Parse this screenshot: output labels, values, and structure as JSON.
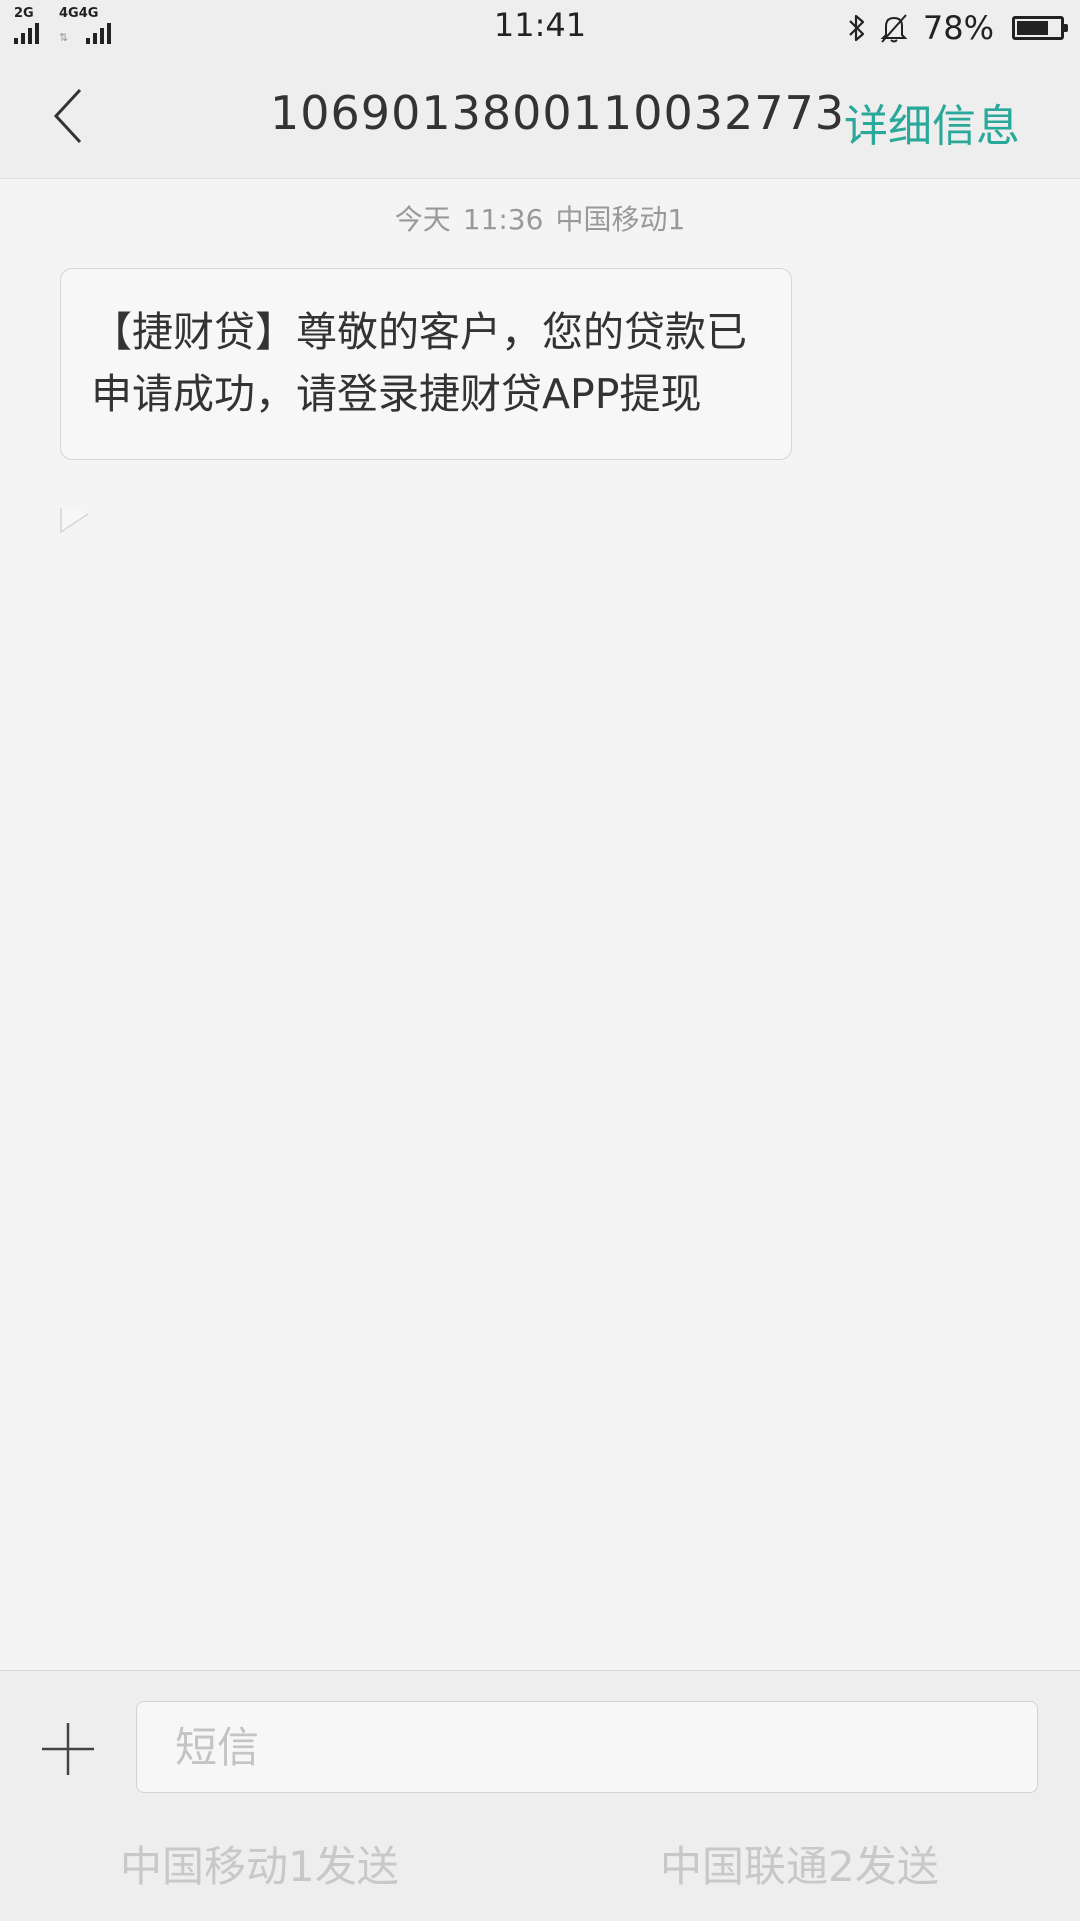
{
  "status_bar": {
    "sim1_type": "2G",
    "sim2_type": "4G",
    "sim2_extra": "4G",
    "time": "11:41",
    "battery_percent": "78%",
    "battery_level": 0.78,
    "icons": [
      "signal-icon",
      "bluetooth-icon",
      "bell-muted-icon",
      "battery-icon"
    ]
  },
  "header": {
    "title": "1069013800110032773",
    "details_label": "详细信息",
    "back_icon": "chevron-left-icon",
    "accent_color": "#2aa89a"
  },
  "conversation": {
    "timestamp_day": "今天",
    "timestamp_time": "11:36",
    "timestamp_sim": "中国移动1",
    "messages": [
      {
        "text": "【捷财贷】尊敬的客户，您的贷款已申请成功，请登录捷财贷APP提现"
      }
    ]
  },
  "composer": {
    "placeholder": "短信",
    "add_icon": "plus-icon",
    "send_sim1_label": "中国移动1发送",
    "send_sim2_label": "中国联通2发送"
  }
}
